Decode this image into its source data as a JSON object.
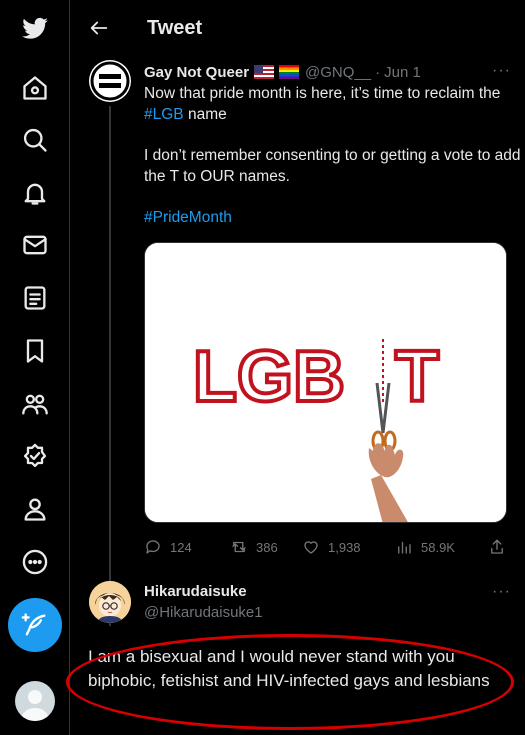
{
  "header": {
    "title": "Tweet"
  },
  "sidebar": {
    "items": [
      {
        "icon": "twitter-logo-icon"
      },
      {
        "icon": "home-icon"
      },
      {
        "icon": "explore-icon"
      },
      {
        "icon": "notifications-icon"
      },
      {
        "icon": "messages-icon"
      },
      {
        "icon": "lists-icon"
      },
      {
        "icon": "bookmarks-icon"
      },
      {
        "icon": "communities-icon"
      },
      {
        "icon": "verified-icon"
      },
      {
        "icon": "profile-icon"
      },
      {
        "icon": "more-icon"
      }
    ],
    "compose_icon": "compose-tweet-icon",
    "accent": "#1d9bf0"
  },
  "tweet": {
    "author_name": "Gay Not Queer",
    "handle": "@GNQ__",
    "separator": "·",
    "date": "Jun 1",
    "more": "···",
    "line1_prefix": "Now that pride month is here, it’s time to reclaim the ",
    "line1_hashtag": "#LGB",
    "line1_suffix": " name",
    "paragraph2": "I don’t remember consenting to or getting a vote to add the T to OUR names.",
    "hashtag2": "#PrideMonth",
    "image_text_left": "LGB",
    "image_text_right": "T",
    "stats": {
      "replies": "124",
      "retweets": "386",
      "likes": "1,938",
      "views": "58.9K"
    }
  },
  "reply": {
    "author_name": "Hikarudaisuke",
    "handle": "@Hikarudaisuke1",
    "more": "···",
    "text": "I am a bisexual and I would never stand with you biphobic, fetishist and HIV-infected gays and lesbians",
    "highlight_color": "#d60000"
  }
}
